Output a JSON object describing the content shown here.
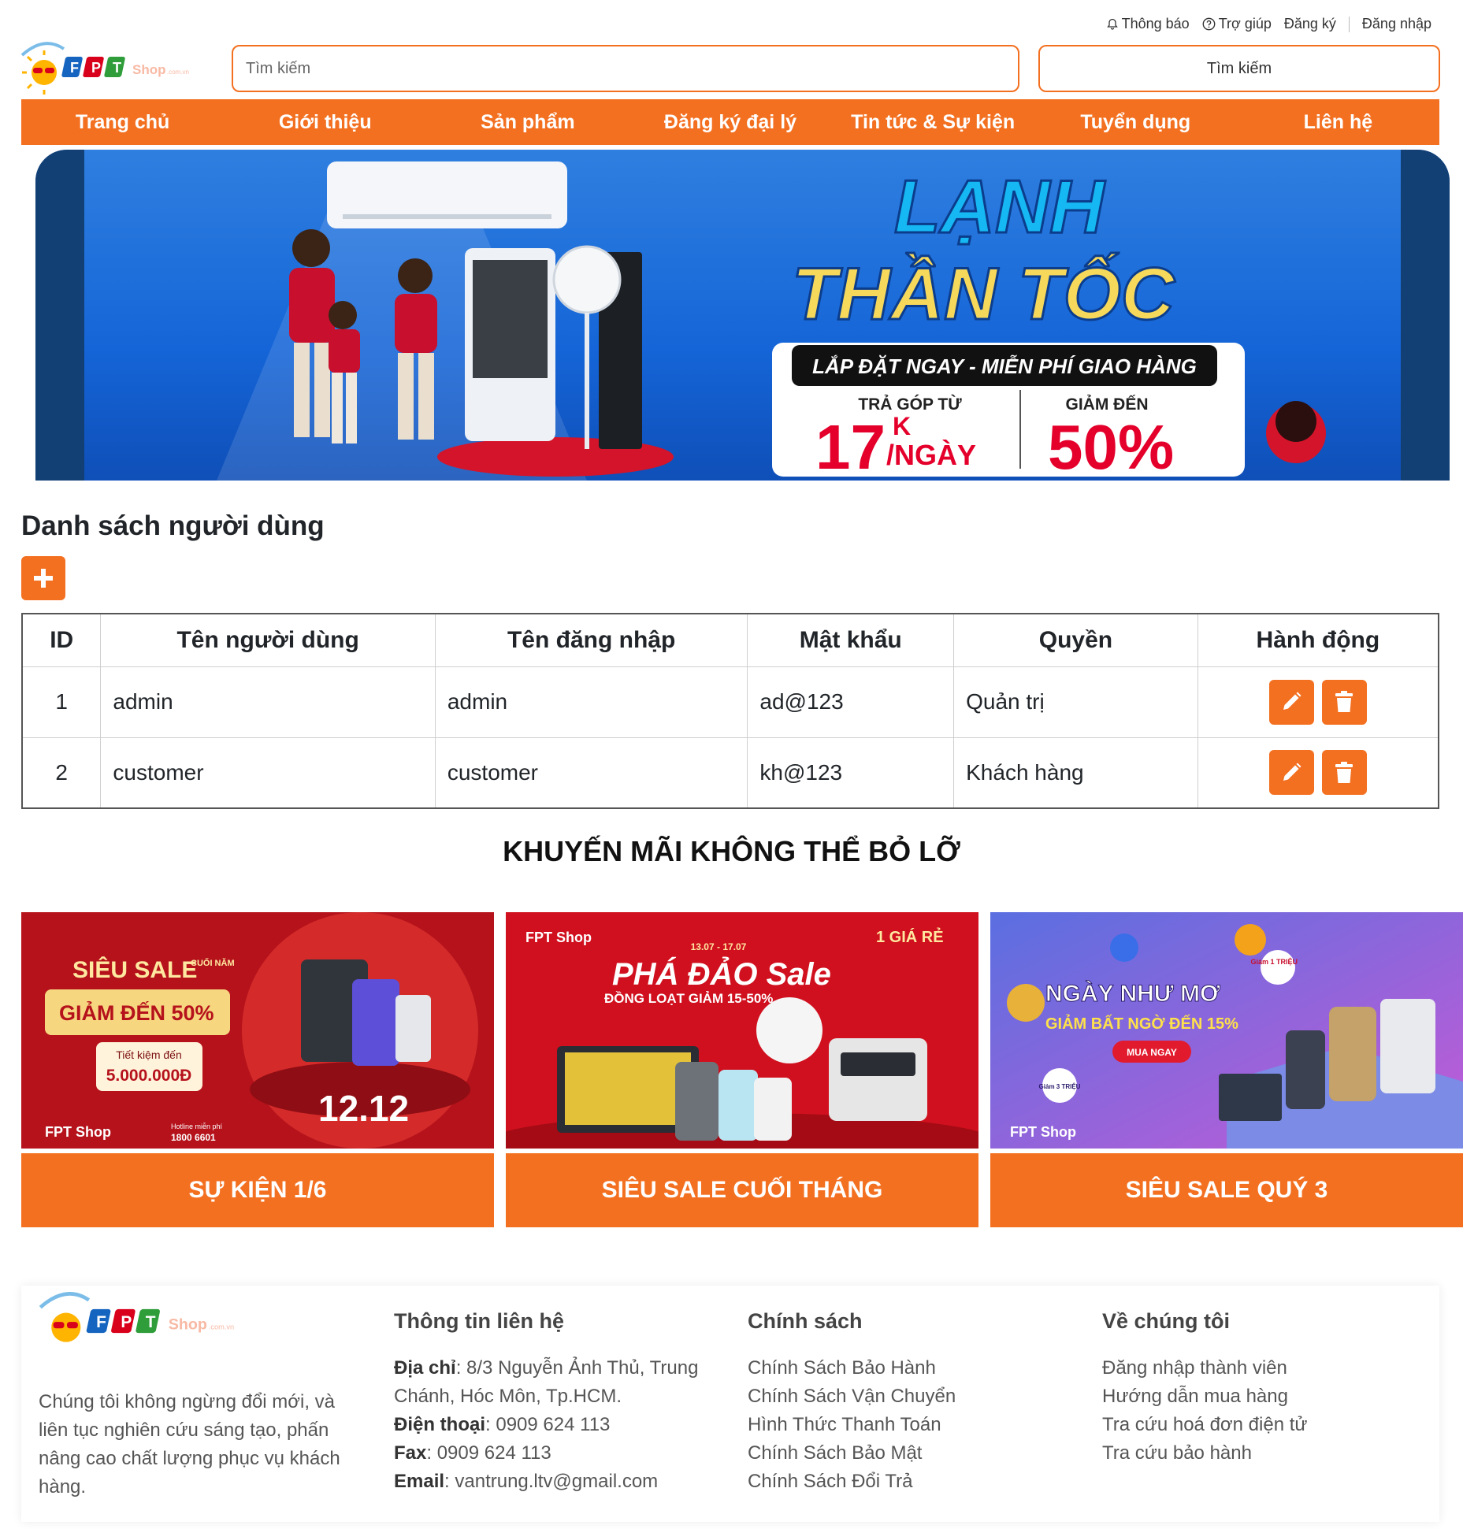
{
  "toplinks": {
    "notifications": "Thông báo",
    "help": "Trợ giúp",
    "register": "Đăng ký",
    "login": "Đăng nhập"
  },
  "search": {
    "placeholder": "Tìm kiếm",
    "button_label": "Tìm kiếm"
  },
  "nav": [
    "Trang chủ",
    "Giới thiệu",
    "Sản phẩm",
    "Đăng ký đại lý",
    "Tin tức & Sự kiện",
    "Tuyển dụng",
    "Liên hệ"
  ],
  "banner": {
    "headline_1": "LẠNH",
    "headline_2": "THẦN TỐC",
    "tagline": "LẮP ĐẶT NGAY - MIỄN PHÍ GIAO HÀNG",
    "offer_1_label": "TRẢ GÓP TỪ",
    "offer_1_value": "17",
    "offer_1_unit_top": "K",
    "offer_1_unit": "/NGÀY",
    "offer_2_label": "GIẢM ĐẾN",
    "offer_2_value": "50%"
  },
  "users": {
    "title": "Danh sách người dùng",
    "headers": [
      "ID",
      "Tên người dùng",
      "Tên đăng nhập",
      "Mật khẩu",
      "Quyền",
      "Hành động"
    ],
    "rows": [
      {
        "id": "1",
        "name": "admin",
        "username": "admin",
        "password": "ad@123",
        "role": "Quản trị"
      },
      {
        "id": "2",
        "name": "customer",
        "username": "customer",
        "password": "kh@123",
        "role": "Khách hàng"
      }
    ]
  },
  "promo": {
    "title": "KHUYẾN MÃI KHÔNG THỂ BỎ LỠ",
    "cards": [
      {
        "button": "SỰ KIỆN 1/6",
        "img_line_1": "SIÊU SALE",
        "img_line_1b": "CUỐI NĂM",
        "img_line_2": "GIẢM ĐẾN 50%",
        "img_line_3": "Tiết kiệm đến",
        "img_line_4": "5.000.000Đ",
        "img_line_5": "12.12",
        "hotline": "Hotline miễn phí",
        "hotline_no": "1800 6601"
      },
      {
        "button": "SIÊU SALE CUỐI THÁNG",
        "img_line_1": "13.07 - 17.07",
        "img_line_2": "PHÁ ĐẢO Sale",
        "img_line_3": "ĐỒNG LOẠT GIẢM 15-50%",
        "img_line_4": "1 GIÁ RẺ"
      },
      {
        "button": "SIÊU SALE QUÝ 3",
        "img_line_1": "NGÀY NHƯ MƠ",
        "img_line_2": "GIẢM BẤT NGỜ ĐẾN 15%",
        "img_line_3": "MUA NGAY",
        "tag_1": "Giảm 1 TRIỆU",
        "tag_2": "Giảm 3 TRIỆU"
      }
    ]
  },
  "logo_text": "FPT Shop",
  "footer": {
    "about": "Chúng tôi không ngừng đổi mới, và liên tục nghiên cứu sáng tạo, phấn nâng cao chất lượng phục vụ khách hàng.",
    "contact_title": "Thông tin liên hệ",
    "address_label": "Địa chỉ",
    "address": ": 8/3 Nguyễn Ảnh Thủ, Trung Chánh, Hóc Môn, Tp.HCM.",
    "phone_label": "Điện thoại",
    "phone": ": 0909 624 113",
    "fax_label": "Fax",
    "fax": ": 0909 624 113",
    "email_label": "Email",
    "email": ": vantrung.ltv@gmail.com",
    "policy_title": "Chính sách",
    "policies": [
      "Chính Sách Bảo Hành",
      "Chính Sách Vận Chuyển",
      "Hình Thức Thanh Toán",
      "Chính Sách Bảo Mật",
      "Chính Sách Đổi Trả"
    ],
    "about_title": "Về chúng tôi",
    "about_links": [
      "Đăng nhập thành viên",
      "Hướng dẫn mua hàng",
      "Tra cứu hoá đơn điện tử",
      "Tra cứu bảo hành"
    ]
  },
  "colors": {
    "accent": "#f37021",
    "banner_blue": "#1565d8",
    "promo_red": "#c8102e"
  }
}
